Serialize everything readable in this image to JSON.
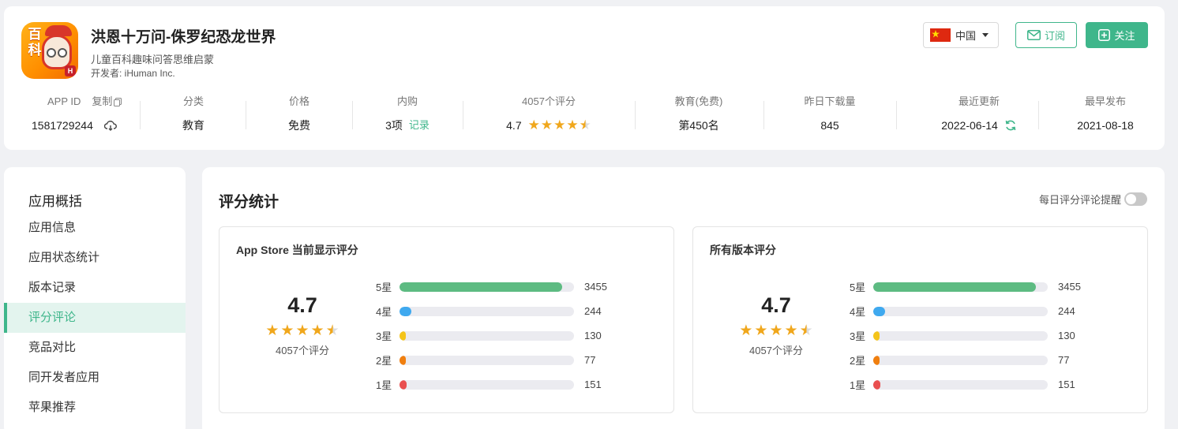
{
  "app": {
    "name": "洪恩十万问-侏罗纪恐龙世界",
    "subtitle": "儿童百科趣味问答思维启蒙",
    "developer": "开发者: iHuman Inc.",
    "icon_text_1": "百",
    "icon_text_2": "科",
    "icon_badge": "H"
  },
  "header": {
    "country": "中国",
    "subscribe_label": "订阅",
    "follow_label": "关注",
    "accent_color": "#3fb68b"
  },
  "stats": {
    "app_id_label": "APP ID",
    "copy_label": "复制",
    "app_id": "1581729244",
    "category_label": "分类",
    "category": "教育",
    "price_label": "价格",
    "price": "免费",
    "iap_label": "内购",
    "iap_value": "3项",
    "iap_link": "记录",
    "ratings_label": "4057个评分",
    "rating": "4.7",
    "rank_label": "教育(免费)",
    "rank": "第450名",
    "downloads_label": "昨日下载量",
    "downloads": "845",
    "updated_label": "最近更新",
    "updated": "2022-06-14",
    "released_label": "最早发布",
    "released": "2021-08-18"
  },
  "sidebar": {
    "heading": "应用概括",
    "items": [
      {
        "label": "应用信息",
        "active": false
      },
      {
        "label": "应用状态统计",
        "active": false
      },
      {
        "label": "版本记录",
        "active": false
      },
      {
        "label": "评分评论",
        "active": true
      },
      {
        "label": "竞品对比",
        "active": false
      },
      {
        "label": "同开发者应用",
        "active": false
      },
      {
        "label": "苹果推荐",
        "active": false
      }
    ]
  },
  "main": {
    "title": "评分统计",
    "reminder_label": "每日评分评论提醒",
    "reminder_on": false
  },
  "panels": [
    {
      "title": "App Store 当前显示评分",
      "score": "4.7",
      "rating_value": 4.7,
      "count": "4057个评分",
      "rows": [
        {
          "label": "5星",
          "value": 3455,
          "display": "3455",
          "color": "#5dbb82"
        },
        {
          "label": "4星",
          "value": 244,
          "display": "244",
          "color": "#3fa9ef"
        },
        {
          "label": "3星",
          "value": 130,
          "display": "130",
          "color": "#f4c41a"
        },
        {
          "label": "2星",
          "value": 77,
          "display": "77",
          "color": "#f07f0f"
        },
        {
          "label": "1星",
          "value": 151,
          "display": "151",
          "color": "#e94f4f"
        }
      ]
    },
    {
      "title": "所有版本评分",
      "score": "4.7",
      "rating_value": 4.7,
      "count": "4057个评分",
      "rows": [
        {
          "label": "5星",
          "value": 3455,
          "display": "3455",
          "color": "#5dbb82"
        },
        {
          "label": "4星",
          "value": 244,
          "display": "244",
          "color": "#3fa9ef"
        },
        {
          "label": "3星",
          "value": 130,
          "display": "130",
          "color": "#f4c41a"
        },
        {
          "label": "2星",
          "value": 77,
          "display": "77",
          "color": "#f07f0f"
        },
        {
          "label": "1星",
          "value": 151,
          "display": "151",
          "color": "#e94f4f"
        }
      ]
    }
  ]
}
